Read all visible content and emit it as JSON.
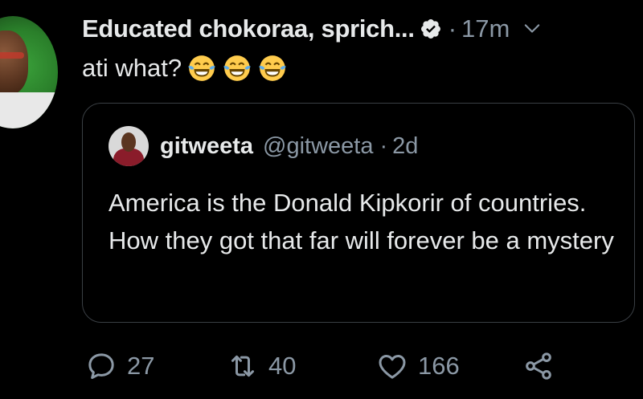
{
  "tweet": {
    "display_name": "Educated chokoraa, sprich...",
    "time_separator": "·",
    "time": "17m",
    "text": "ati what?",
    "emoji": "face-with-tears-of-joy"
  },
  "quote": {
    "name": "gitweeta",
    "handle": "@gitweeta",
    "time_separator": "·",
    "time": "2d",
    "text": "America is the Donald Kipkorir of countries. How they got that far will forever be a mystery"
  },
  "actions": {
    "reply_count": "27",
    "retweet_count": "40",
    "like_count": "166"
  },
  "colors": {
    "background": "#000000",
    "text": "#e7e9ea",
    "muted": "#8b98a5",
    "border": "#3a3f44",
    "verified_badge": "#e7e9ea"
  }
}
